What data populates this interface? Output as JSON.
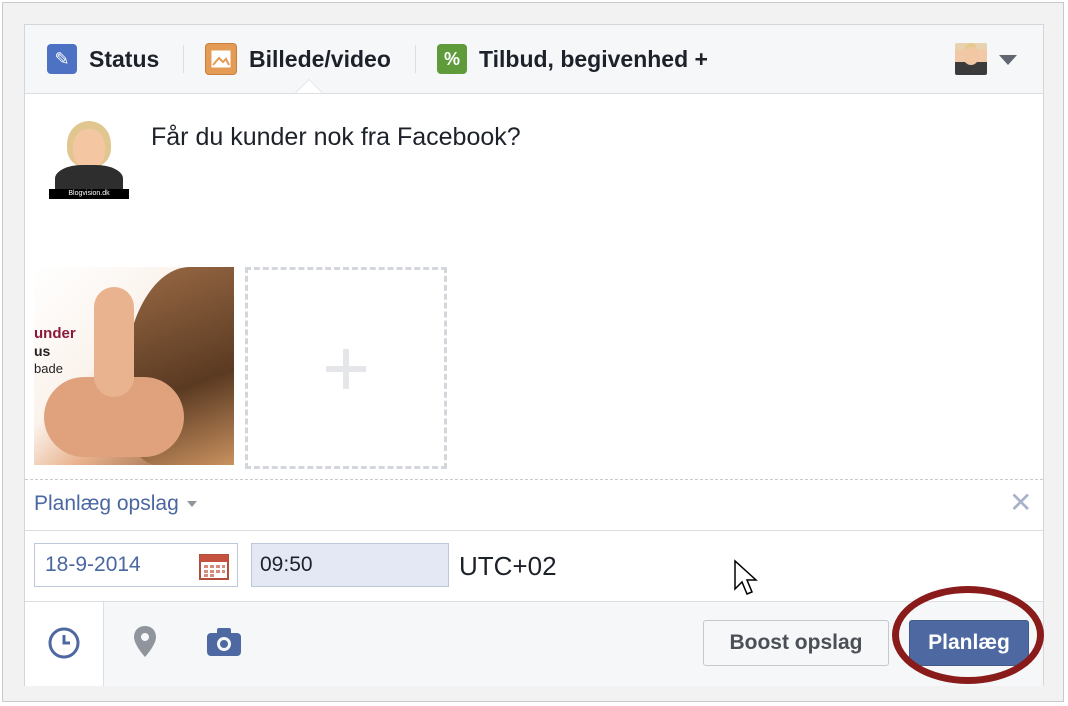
{
  "tabs": [
    {
      "label": "Status",
      "icon": "pencil-icon",
      "color": "#4e72c3"
    },
    {
      "label": "Billede/video",
      "icon": "photo-icon",
      "color": "#e49b55"
    },
    {
      "label": "Tilbud, begivenhed +",
      "icon": "offer-icon",
      "color": "#5f9b3a"
    }
  ],
  "post": {
    "text": "Får du kunder nok fra Facebook?",
    "avatar_caption": "Blogvision.dk"
  },
  "attachment": {
    "line1": "under",
    "line2": "us",
    "line3": "bade"
  },
  "schedule": {
    "label": "Planlæg opslag",
    "date": "18-9-2014",
    "time": "09:50",
    "timezone": "UTC+02"
  },
  "footer": {
    "boost_label": "Boost opslag",
    "schedule_label": "Planlæg"
  },
  "colors": {
    "accent": "#4e69a2",
    "link": "#4b67a1",
    "highlight": "#8a1b1b"
  }
}
